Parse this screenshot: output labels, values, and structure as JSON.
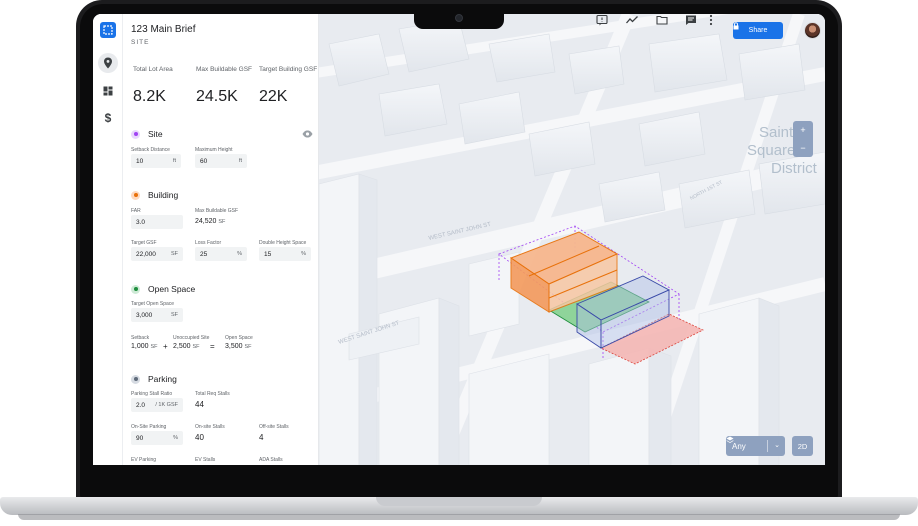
{
  "app": {
    "title": "123 Main Brief",
    "subtitle": "SITE"
  },
  "kpis": [
    {
      "label": "Total Lot Area",
      "value": "8.2K"
    },
    {
      "label": "Max Buildable GSF",
      "value": "24.5K"
    },
    {
      "label": "Target Building GSF",
      "value": "22K"
    }
  ],
  "site": {
    "title": "Site",
    "color": "#a142f4",
    "setback_label": "Setback Distance",
    "setback_value": "10",
    "setback_unit": "ft",
    "max_height_label": "Maximum Height",
    "max_height_value": "60",
    "max_height_unit": "ft"
  },
  "building": {
    "title": "Building",
    "color": "#e8710a",
    "far_label": "FAR",
    "far_value": "3.0",
    "max_gsf_label": "Max Buildable GSF",
    "max_gsf_value": "24,520",
    "max_gsf_unit": "SF",
    "target_gsf_label": "Target GSF",
    "target_gsf_value": "22,000",
    "target_gsf_unit": "SF",
    "loss_factor_label": "Loss Factor",
    "loss_factor_value": "25",
    "loss_factor_unit": "%",
    "double_height_label": "Double Height Space",
    "double_height_value": "15",
    "double_height_unit": "%"
  },
  "open_space": {
    "title": "Open Space",
    "color": "#1e8e3e",
    "target_label": "Target Open Space",
    "target_value": "3,000",
    "target_unit": "SF",
    "setback_label": "Setback",
    "setback_value": "1,000",
    "setback_unit": "SF",
    "plus": "+",
    "unoccupied_label": "Unoccupied Site",
    "unoccupied_value": "2,500",
    "unoccupied_unit": "SF",
    "equals": "=",
    "open_label": "Open Space",
    "open_value": "3,500",
    "open_unit": "SF"
  },
  "parking": {
    "title": "Parking",
    "color": "#5f6b7a",
    "ratio_label": "Parking Stall Ratio",
    "ratio_value": "2.0",
    "ratio_unit": "/ 1K GSF",
    "total_label": "Total Req Stalls",
    "total_value": "44",
    "onsite_pct_label": "On-Site Parking",
    "onsite_pct_value": "90",
    "onsite_pct_unit": "%",
    "onsite_stalls_label": "On-site Stalls",
    "onsite_stalls_value": "40",
    "offsite_stalls_label": "Off-site Stalls",
    "offsite_stalls_value": "4",
    "ev_parking_label": "EV Parking",
    "ev_stalls_label": "EV Stalls",
    "ada_stalls_label": "ADA Stalls"
  },
  "toolbar": {
    "share_label": "Share"
  },
  "map": {
    "district_label_1": "Saint",
    "district_label_2": "Square",
    "district_label_3": "District",
    "street_1": "WEST SAINT JOHN ST",
    "street_2": "WEST SAINT JOHN ST",
    "street_3": "NORTH 1ST ST",
    "zoom_in": "+",
    "zoom_out": "−",
    "layer_label": "Any",
    "view_mode": "2D"
  }
}
